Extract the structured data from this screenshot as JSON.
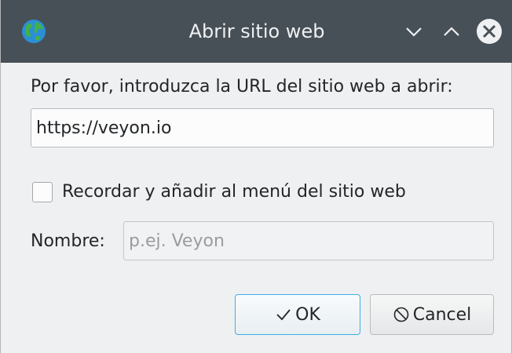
{
  "window": {
    "title": "Abrir sitio web",
    "icon": "globe-icon",
    "controls": [
      "minimize-icon",
      "maximize-icon",
      "close-icon"
    ]
  },
  "form": {
    "url_label": "Por favor, introduzca la URL del sitio web a abrir:",
    "url_value": "https://veyon.io",
    "remember_label": "Recordar y añadir al menú del sitio web",
    "remember_checked": false,
    "name_label": "Nombre:",
    "name_placeholder": "p.ej. Veyon",
    "name_value": ""
  },
  "buttons": {
    "ok_label": "OK",
    "ok_icon": "check-icon",
    "cancel_label": "Cancel",
    "cancel_icon": "cancel-icon"
  },
  "colors": {
    "titlebar": "#475057",
    "window_bg": "#eff0f1",
    "focus_accent": "#3daee9"
  }
}
